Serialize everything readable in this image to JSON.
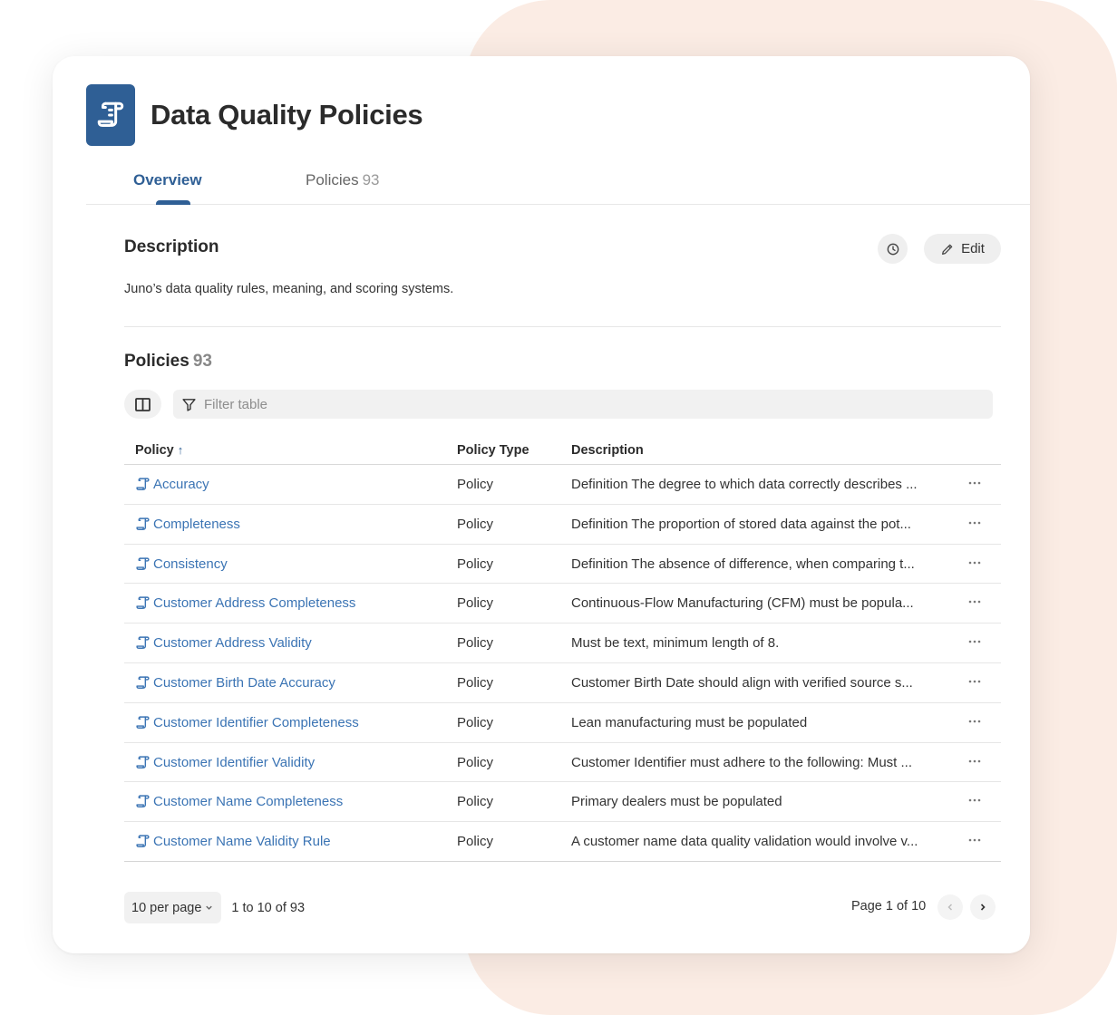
{
  "header": {
    "title": "Data Quality Policies",
    "icon": "policy-document-icon"
  },
  "tabs": [
    {
      "label": "Overview",
      "active": true
    },
    {
      "label": "Policies",
      "count": "93",
      "active": false
    }
  ],
  "description": {
    "heading": "Description",
    "text": "Juno’s data quality rules, meaning, and scoring systems.",
    "edit_label": "Edit"
  },
  "policies": {
    "heading": "Policies",
    "count": "93",
    "filter_placeholder": "Filter table",
    "columns": {
      "policy": "Policy",
      "type": "Policy Type",
      "description": "Description"
    },
    "sort": {
      "column": "Policy",
      "direction": "ascending"
    },
    "rows": [
      {
        "name": "Accuracy",
        "type": "Policy",
        "description": "Definition The degree to which data correctly describes ..."
      },
      {
        "name": "Completeness",
        "type": "Policy",
        "description": "Definition The proportion of stored data against the pot..."
      },
      {
        "name": "Consistency",
        "type": "Policy",
        "description": "Definition The absence of difference, when comparing t..."
      },
      {
        "name": "Customer Address Completeness",
        "type": "Policy",
        "description": "Continuous-Flow Manufacturing (CFM) must be popula..."
      },
      {
        "name": "Customer Address Validity",
        "type": "Policy",
        "description": "Must be text, minimum length of 8."
      },
      {
        "name": "Customer Birth Date Accuracy",
        "type": "Policy",
        "description": "Customer Birth Date should align with verified source s..."
      },
      {
        "name": "Customer Identifier Completeness",
        "type": "Policy",
        "description": "Lean manufacturing must be populated"
      },
      {
        "name": "Customer Identifier Validity",
        "type": "Policy",
        "description": "Customer Identifier must adhere to the following: Must ..."
      },
      {
        "name": "Customer Name Completeness",
        "type": "Policy",
        "description": "Primary dealers must be populated"
      },
      {
        "name": "Customer Name Validity Rule",
        "type": "Policy",
        "description": "A customer name data quality validation would involve v..."
      }
    ]
  },
  "pagination": {
    "per_page_label": "10 per page",
    "range_text": "1 to 10 of 93",
    "page_text": "Page 1 of 10"
  },
  "colors": {
    "accent": "#2f5f95",
    "link": "#3b74b4",
    "background_blob": "#fbece4"
  }
}
